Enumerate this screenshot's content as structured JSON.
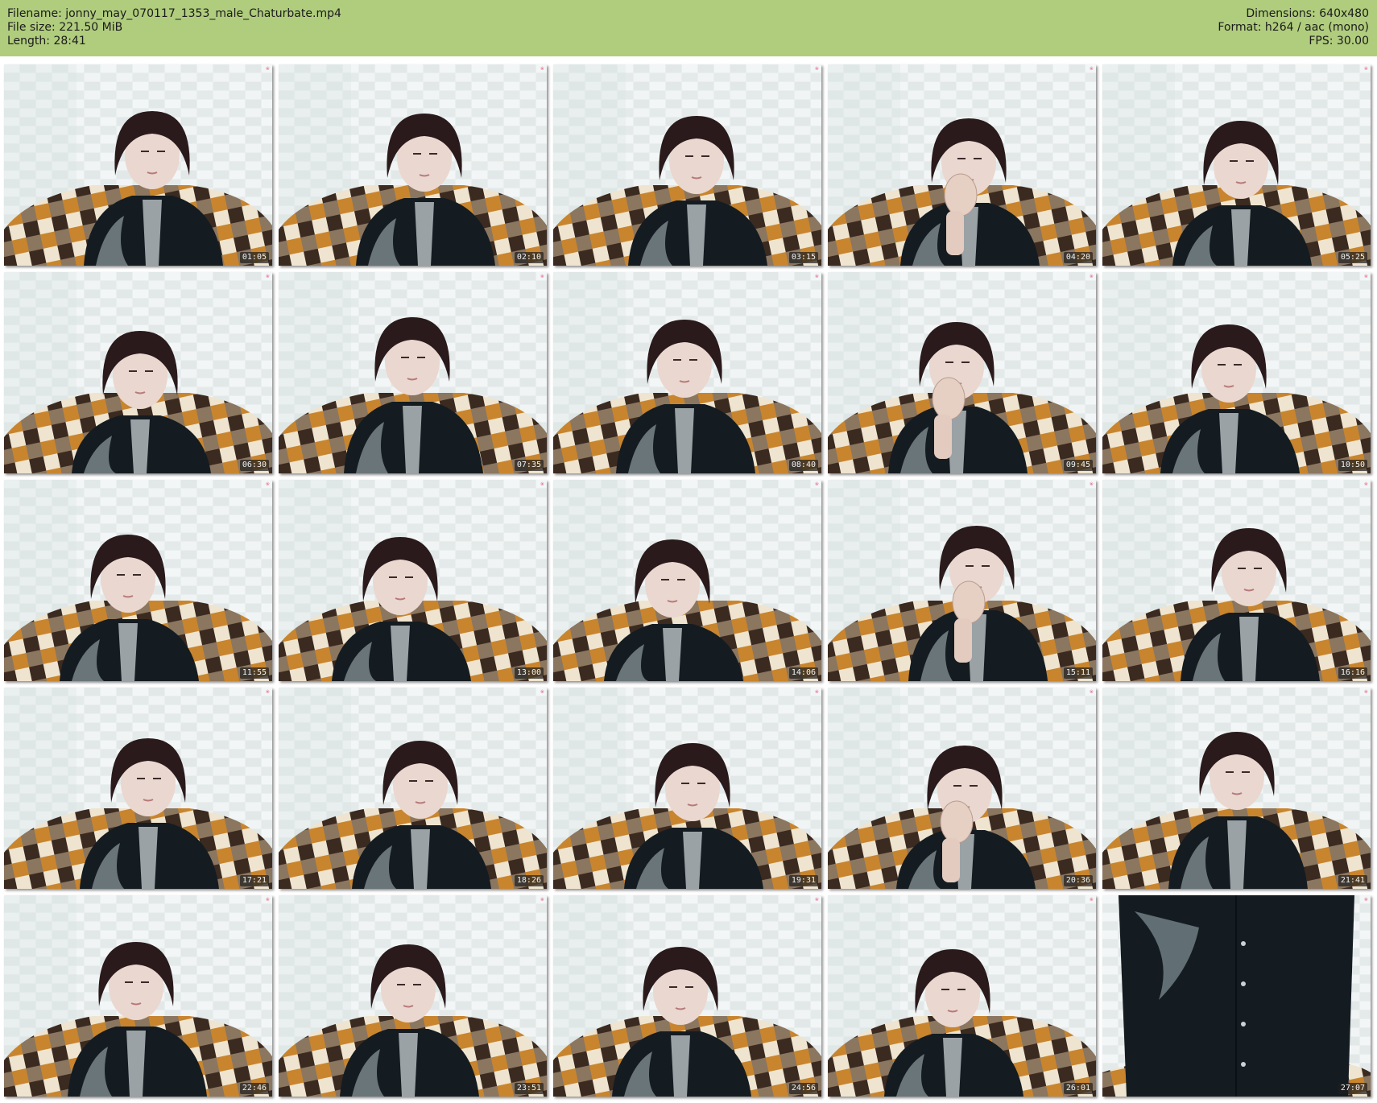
{
  "header": {
    "filename_line": "Filename:  jonny_may_070117_1353_male_Chaturbate.mp4",
    "filesize_line": "File size: 221.50 MiB",
    "length_line": "Length: 28:41",
    "dimensions_line": "Dimensions: 640x480",
    "format_line": "Format: h264 / aac (mono)",
    "fps_line": "FPS: 30.00"
  },
  "colors": {
    "header_bg": "#b0cc7d",
    "timestamp_bg": "#333333",
    "hair": "#2a1a1c",
    "jacket": "#141c21",
    "blanket_orange": "#c8852e",
    "wall": "#e9eeee"
  },
  "thumbnails": [
    {
      "time": "01:05",
      "variant": "face"
    },
    {
      "time": "02:10",
      "variant": "face"
    },
    {
      "time": "03:15",
      "variant": "face"
    },
    {
      "time": "04:20",
      "variant": "hand"
    },
    {
      "time": "05:25",
      "variant": "face"
    },
    {
      "time": "06:30",
      "variant": "face"
    },
    {
      "time": "07:35",
      "variant": "face"
    },
    {
      "time": "08:40",
      "variant": "face"
    },
    {
      "time": "09:45",
      "variant": "hand"
    },
    {
      "time": "10:50",
      "variant": "face"
    },
    {
      "time": "11:55",
      "variant": "face"
    },
    {
      "time": "13:00",
      "variant": "face"
    },
    {
      "time": "14:06",
      "variant": "face"
    },
    {
      "time": "15:11",
      "variant": "hand"
    },
    {
      "time": "16:16",
      "variant": "face"
    },
    {
      "time": "17:21",
      "variant": "face"
    },
    {
      "time": "18:26",
      "variant": "face"
    },
    {
      "time": "19:31",
      "variant": "face"
    },
    {
      "time": "20:36",
      "variant": "hand"
    },
    {
      "time": "21:41",
      "variant": "face"
    },
    {
      "time": "22:46",
      "variant": "face"
    },
    {
      "time": "23:51",
      "variant": "face"
    },
    {
      "time": "24:56",
      "variant": "face"
    },
    {
      "time": "26:01",
      "variant": "face"
    },
    {
      "time": "27:07",
      "variant": "shirt"
    }
  ],
  "watermark_icon": "camgirl-watermark-logo"
}
